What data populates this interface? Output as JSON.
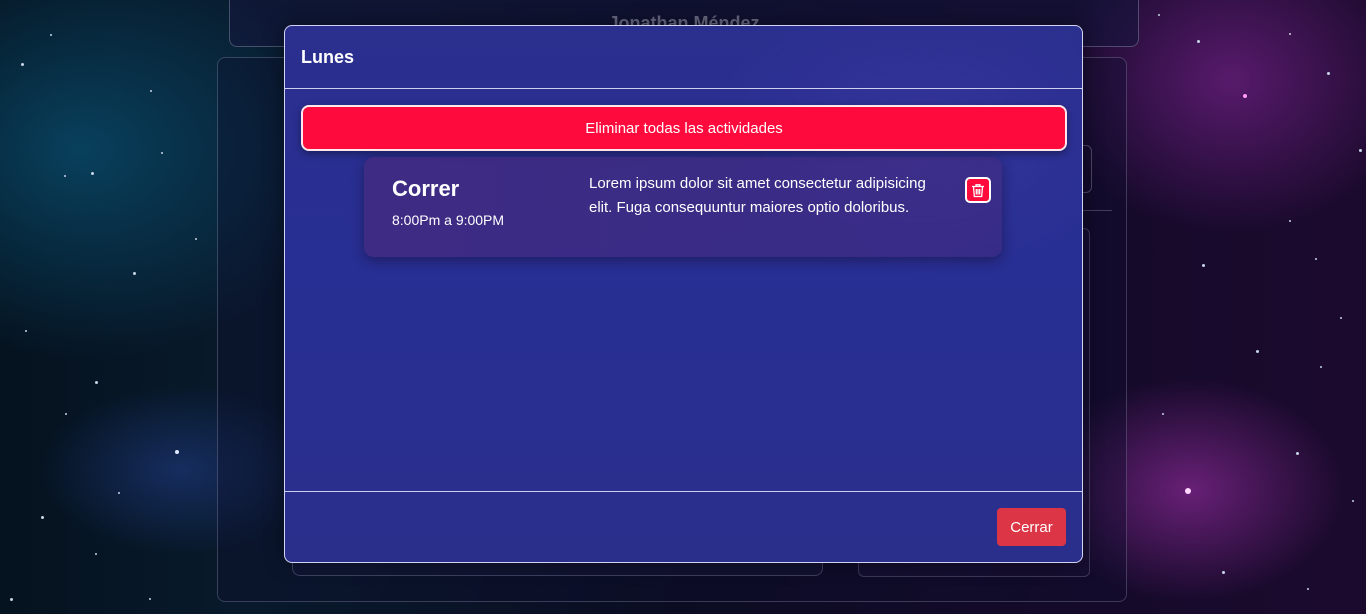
{
  "background": {
    "header_name": "Jonathan Méndez"
  },
  "modal": {
    "title": "Lunes",
    "delete_all_label": "Eliminar todas las actividades",
    "activities": [
      {
        "name": "Correr",
        "time": "8:00Pm a 9:00PM",
        "description": "Lorem ipsum dolor sit amet consectetur adipisicing elit. Fuga consequuntur maiores optio doloribus.",
        "delete_icon": "trash-icon"
      }
    ],
    "close_label": "Cerrar"
  },
  "colors": {
    "danger_bright": "#ff0a3c",
    "danger_button": "#dc3545",
    "modal_bg": "#2a2f8e"
  }
}
